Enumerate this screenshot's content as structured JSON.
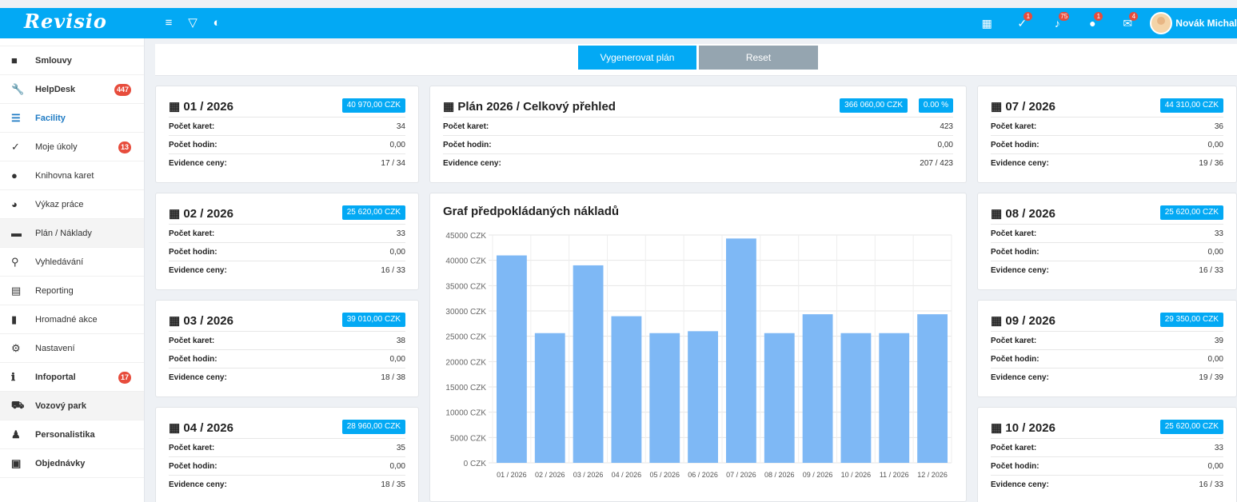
{
  "app": {
    "logo": "Revisio",
    "user_name": "Novák Michal"
  },
  "topbar": {
    "left_icons": [
      "menu-icon",
      "filter-icon",
      "toggle-icon"
    ],
    "right_icons": [
      {
        "name": "calendar-icon",
        "glyph": "▦",
        "badge": ""
      },
      {
        "name": "tasks-icon",
        "glyph": "✓",
        "badge": "1"
      },
      {
        "name": "bell-icon",
        "glyph": "♪",
        "badge": "75"
      },
      {
        "name": "chat-icon",
        "glyph": "●",
        "badge": "1"
      },
      {
        "name": "mail-icon",
        "glyph": "✉",
        "badge": "4"
      }
    ]
  },
  "sidebar": {
    "items": [
      {
        "label": "Smlouvy",
        "icon": "folder-icon",
        "glyph": "■",
        "bold": true,
        "count": ""
      },
      {
        "label": "HelpDesk",
        "icon": "wrench-icon",
        "glyph": "🔧",
        "bold": true,
        "count": "447"
      },
      {
        "label": "Facility",
        "icon": "list-check-icon",
        "glyph": "☰",
        "bold": true,
        "count": "",
        "active": true
      },
      {
        "label": "Moje úkoly",
        "icon": "check-icon",
        "glyph": "✓",
        "bold": false,
        "count": "13"
      },
      {
        "label": "Knihovna karet",
        "icon": "database-icon",
        "glyph": "●",
        "bold": false,
        "count": ""
      },
      {
        "label": "Výkaz práce",
        "icon": "clock-icon",
        "glyph": "◕",
        "bold": false,
        "count": ""
      },
      {
        "label": "Plán / Náklady",
        "icon": "money-icon",
        "glyph": "▬",
        "bold": false,
        "count": "",
        "selected": true
      },
      {
        "label": "Vyhledávání",
        "icon": "search-icon",
        "glyph": "⚲",
        "bold": false,
        "count": ""
      },
      {
        "label": "Reporting",
        "icon": "report-icon",
        "glyph": "▤",
        "bold": false,
        "count": ""
      },
      {
        "label": "Hromadné akce",
        "icon": "bulk-icon",
        "glyph": "▮",
        "bold": false,
        "count": ""
      },
      {
        "label": "Nastavení",
        "icon": "cogs-icon",
        "glyph": "⚙",
        "bold": false,
        "count": ""
      },
      {
        "label": "Infoportal",
        "icon": "info-icon",
        "glyph": "ℹ",
        "bold": true,
        "count": "17"
      },
      {
        "label": "Vozový park",
        "icon": "car-icon",
        "glyph": "⛟",
        "bold": true,
        "count": "",
        "selected": true
      },
      {
        "label": "Personalistika",
        "icon": "user-check-icon",
        "glyph": "♟",
        "bold": true,
        "count": ""
      },
      {
        "label": "Objednávky",
        "icon": "cart-icon",
        "glyph": "▣",
        "bold": true,
        "count": ""
      }
    ]
  },
  "buttons": {
    "generate": "Vygenerovat plán",
    "reset": "Reset"
  },
  "labels": {
    "cards": "Počet karet:",
    "hours": "Počet hodin:",
    "evidence": "Evidence ceny:"
  },
  "summary": {
    "title": "Plán 2026 / Celkový přehled",
    "amount": "366 060,00 CZK",
    "percent": "0.00 %",
    "cards": "423",
    "hours": "0,00",
    "evidence": "207 / 423"
  },
  "months": [
    {
      "title": "01 / 2026",
      "amount": "40 970,00 CZK",
      "cards": "34",
      "hours": "0,00",
      "evidence": "17 / 34"
    },
    {
      "title": "02 / 2026",
      "amount": "25 620,00 CZK",
      "cards": "33",
      "hours": "0,00",
      "evidence": "16 / 33"
    },
    {
      "title": "03 / 2026",
      "amount": "39 010,00 CZK",
      "cards": "38",
      "hours": "0,00",
      "evidence": "18 / 38"
    },
    {
      "title": "04 / 2026",
      "amount": "28 960,00 CZK",
      "cards": "35",
      "hours": "0,00",
      "evidence": "18 / 35"
    },
    {
      "title": "07 / 2026",
      "amount": "44 310,00 CZK",
      "cards": "36",
      "hours": "0,00",
      "evidence": "19 / 36"
    },
    {
      "title": "08 / 2026",
      "amount": "25 620,00 CZK",
      "cards": "33",
      "hours": "0,00",
      "evidence": "16 / 33"
    },
    {
      "title": "09 / 2026",
      "amount": "29 350,00 CZK",
      "cards": "39",
      "hours": "0,00",
      "evidence": "19 / 39"
    },
    {
      "title": "10 / 2026",
      "amount": "25 620,00 CZK",
      "cards": "33",
      "hours": "0,00",
      "evidence": "16 / 33"
    }
  ],
  "chart_title": "Graf předpokládaných nákladů",
  "chart_data": {
    "type": "bar",
    "title": "Graf předpokládaných nákladů",
    "categories": [
      "01 / 2026",
      "02 / 2026",
      "03 / 2026",
      "04 / 2026",
      "05 / 2026",
      "06 / 2026",
      "07 / 2026",
      "08 / 2026",
      "09 / 2026",
      "10 / 2026",
      "11 / 2026",
      "12 / 2026"
    ],
    "values": [
      40970,
      25620,
      39010,
      28960,
      25620,
      26000,
      44310,
      25620,
      29350,
      25620,
      25620,
      29350
    ],
    "yticks": [
      "0 CZK",
      "5000 CZK",
      "10000 CZK",
      "15000 CZK",
      "20000 CZK",
      "25000 CZK",
      "30000 CZK",
      "35000 CZK",
      "40000 CZK",
      "45000 CZK"
    ],
    "ylim": [
      0,
      45000
    ],
    "bar_color": "#7eb8f5",
    "grid": true
  },
  "colors": {
    "accent": "#03a9f4",
    "badge": "#e74c3c",
    "reset": "#95a5b0"
  }
}
